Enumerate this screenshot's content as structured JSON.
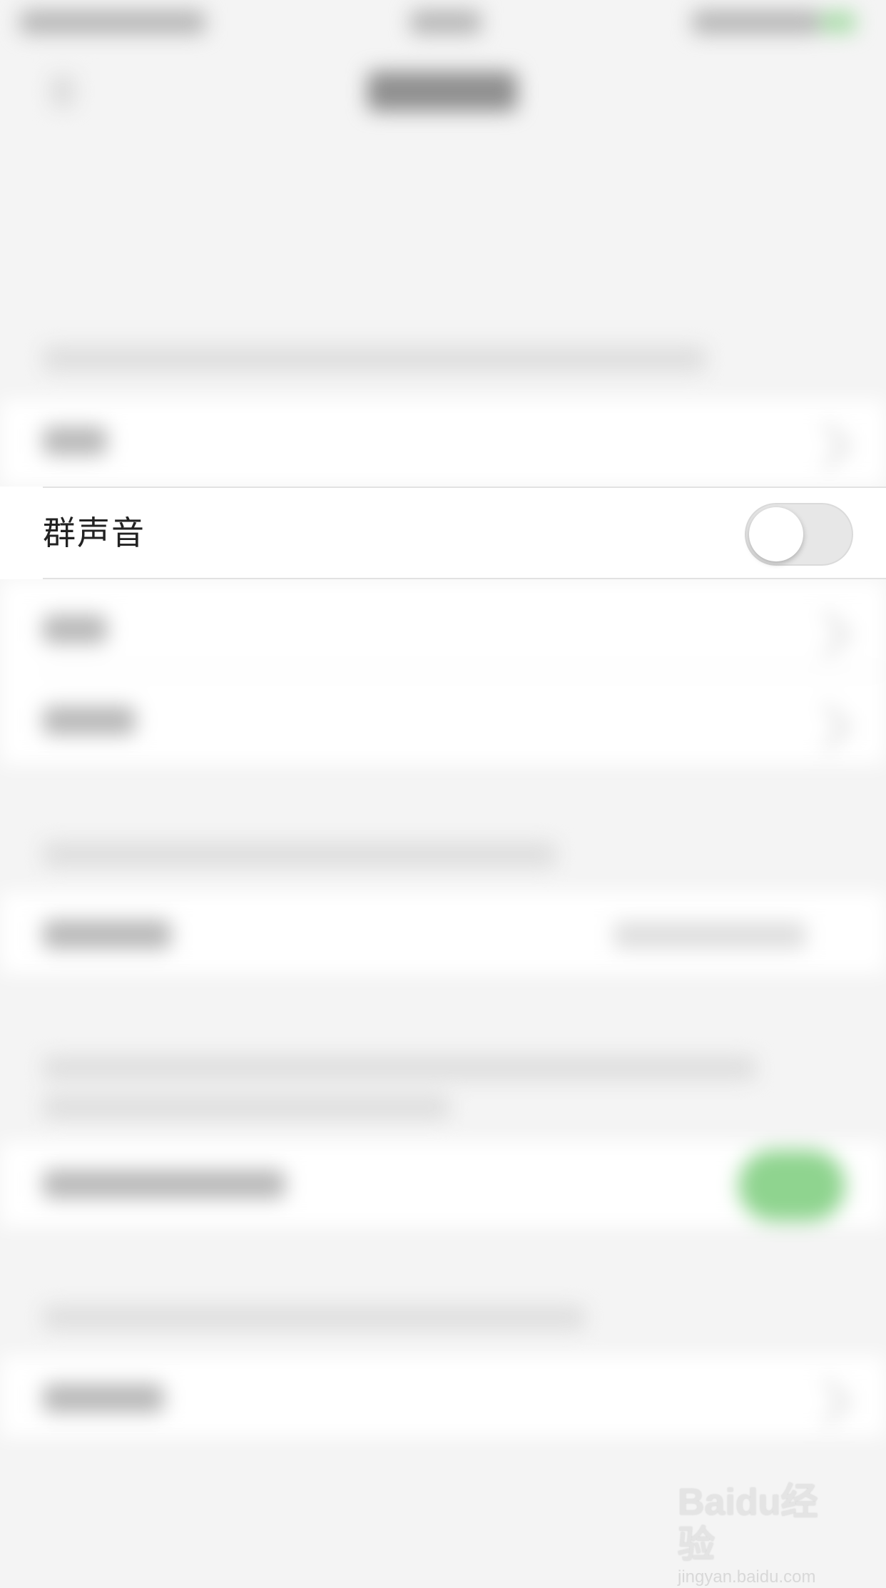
{
  "settings": {
    "group_sound_row": {
      "label": "群声音",
      "toggle_on": false
    }
  },
  "watermark": {
    "logo_text": "Baidu经验",
    "url": "jingyan.baidu.com"
  },
  "colors": {
    "toggle_off_track": "#e7e7e7",
    "toggle_knob": "#ffffff",
    "blurred_accent_green": "#8fd48f",
    "background": "#f4f4f4"
  },
  "icons": {
    "back": "chevron-left-icon",
    "row_disclosure": "chevron-right-icon",
    "status_battery": "battery-icon"
  }
}
